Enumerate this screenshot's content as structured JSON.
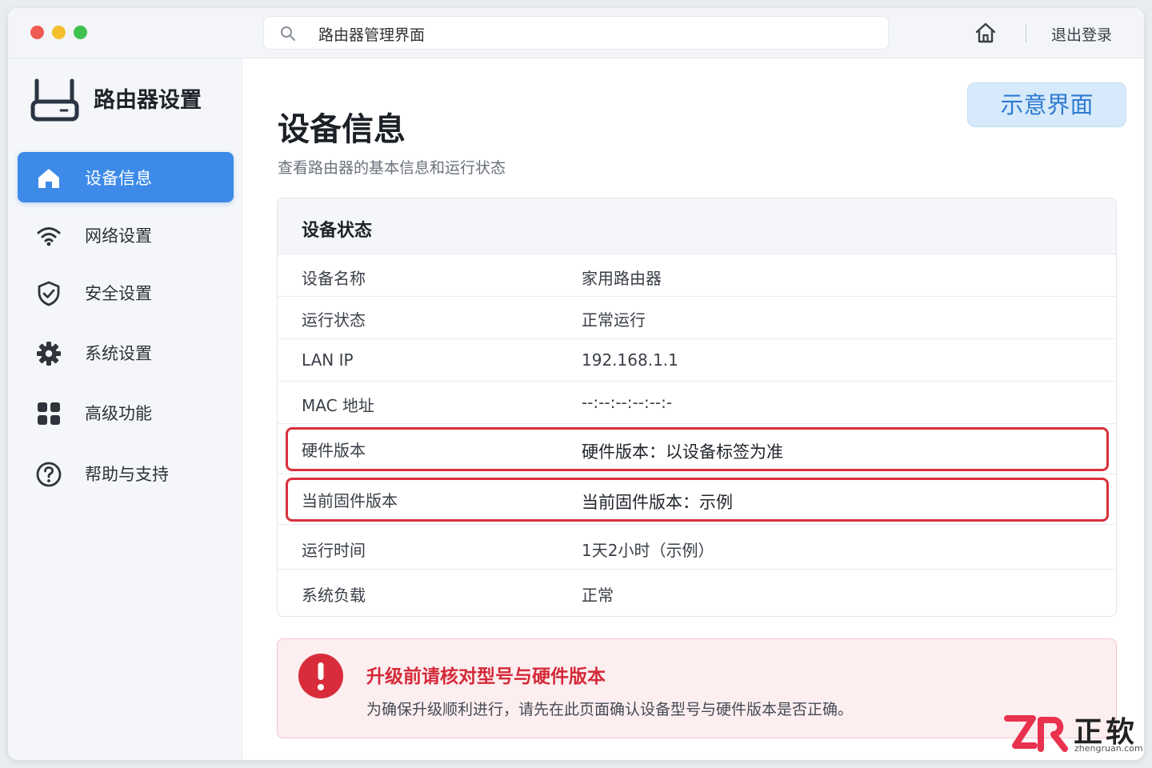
{
  "window": {
    "search_placeholder": "路由器管理界面",
    "logout_label": "退出登录"
  },
  "sidebar": {
    "brand_title": "路由器设置",
    "items": [
      {
        "label": "设备信息",
        "active": true
      },
      {
        "label": "网络设置"
      },
      {
        "label": "安全设置"
      },
      {
        "label": "系统设置"
      },
      {
        "label": "高级功能"
      },
      {
        "label": "帮助与支持"
      }
    ]
  },
  "main": {
    "title": "设备信息",
    "subtitle": "查看路由器的基本信息和运行状态",
    "demo_button": "示意界面",
    "card": {
      "title": "设备状态",
      "rows": [
        {
          "key": "设备名称",
          "value": "家用路由器"
        },
        {
          "key": "运行状态",
          "value": "正常运行"
        },
        {
          "key": "LAN IP",
          "value": "192.168.1.1"
        },
        {
          "key": "MAC 地址",
          "value": "--:--:--:--:--:-"
        },
        {
          "key": "硬件版本",
          "value": "硬件版本：以设备标签为准",
          "highlighted": true
        },
        {
          "key": "当前固件版本",
          "value": "当前固件版本：示例",
          "highlighted": true
        },
        {
          "key": "运行时间",
          "value": "1天2小时（示例）"
        },
        {
          "key": "系统负载",
          "value": "正常"
        }
      ]
    },
    "alert": {
      "title": "升级前请核对型号与硬件版本",
      "text": "为确保升级顺利进行，请先在此页面确认设备型号与硬件版本是否正确。"
    }
  },
  "watermark": {
    "name": "正软",
    "url": "zhengruan.com"
  },
  "colors": {
    "accent": "#3d8ae8",
    "alert_red": "#d9303d",
    "highlight_border": "#d9303d"
  }
}
